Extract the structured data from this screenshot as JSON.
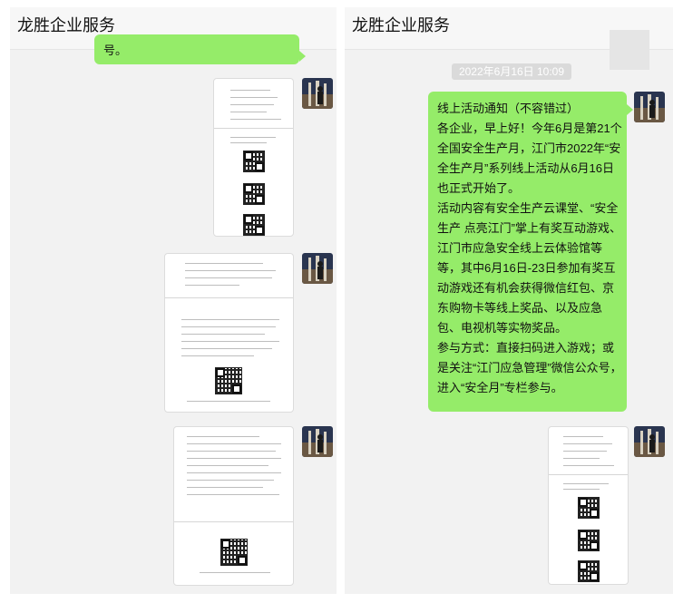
{
  "left_panel": {
    "header": {
      "title": "龙胜企业服务"
    },
    "clipped_bubble_text": "号。"
  },
  "right_panel": {
    "header": {
      "title": "龙胜企业服务"
    },
    "timestamp": "2022年6月16日 10:09",
    "message_text": "线上活动通知（不容错过）\n各企业，早上好！今年6月是第21个全国安全生产月，江门市2022年“安全生产月”系列线上活动从6月16日也正式开始了。\n活动内容有安全生产云课堂、“安全生产 点亮江门”掌上有奖互动游戏、江门市应急安全线上云体验馆等等，其中6月16日-23日参加有奖互动游戏还有机会获得微信红包、京东购物卡等线上奖品、以及应急包、电视机等实物奖品。\n参与方式：直接扫码进入游戏；或是关注“江门应急管理”微信公众号，进入“安全月”专栏参与。"
  },
  "colors": {
    "chat_bg": "#f2f2f2",
    "bubble_green": "#95ec69",
    "timestamp_bg": "#dadada"
  },
  "icons": {
    "avatar": "avatar-photo",
    "qr": "qr-code-icon"
  }
}
